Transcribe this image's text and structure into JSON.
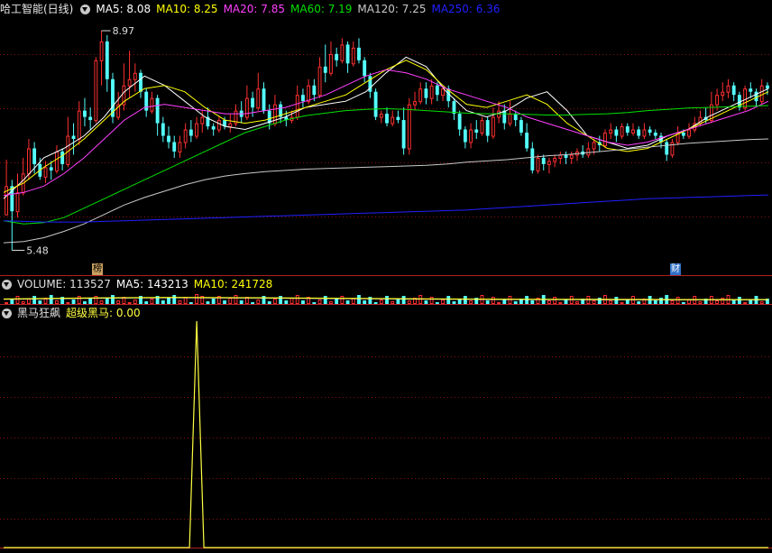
{
  "main": {
    "stock_title": "哈工智能(日线)",
    "ma": [
      {
        "label": "MA5: 8.08",
        "color": "#ffffff"
      },
      {
        "label": "MA10: 8.25",
        "color": "#ffff00"
      },
      {
        "label": "MA20: 7.85",
        "color": "#ff40ff"
      },
      {
        "label": "MA60: 7.19",
        "color": "#00e000"
      },
      {
        "label": "MA120: 7.25",
        "color": "#c8c8c8"
      },
      {
        "label": "MA250: 6.36",
        "color": "#2020ff"
      }
    ],
    "high_label": "8.97",
    "low_label": "5.48",
    "tag_bang": "榜",
    "tag_cai": "财"
  },
  "volume": {
    "label": "VOLUME: 113527",
    "ma5": "MA5: 143213",
    "ma10": "MA10: 241728"
  },
  "indicator": {
    "name": "黑马狂飙",
    "line_label": "超级黑马: 0.00",
    "color": "#ffff40"
  },
  "colors": {
    "up": "#ff3030",
    "down": "#54ffff",
    "grid": "#8a1010"
  },
  "chart_data": {
    "type": "candlestick",
    "price_range": [
      5.3,
      9.2
    ],
    "max_price": 8.97,
    "min_price": 5.48,
    "candles": [
      [
        6.05,
        6.5,
        6.08,
        6.92
      ],
      [
        6.5,
        6.1,
        5.48,
        6.6
      ],
      [
        6.1,
        6.4,
        6.0,
        6.7
      ],
      [
        6.4,
        6.7,
        6.35,
        6.95
      ],
      [
        6.7,
        7.1,
        6.6,
        7.25
      ],
      [
        7.1,
        6.85,
        6.7,
        7.2
      ],
      [
        6.85,
        6.65,
        6.6,
        6.95
      ],
      [
        6.65,
        6.8,
        6.55,
        6.9
      ],
      [
        6.8,
        6.75,
        6.6,
        6.9
      ],
      [
        6.75,
        7.05,
        6.7,
        7.15
      ],
      [
        7.05,
        6.85,
        6.75,
        7.1
      ],
      [
        6.85,
        7.3,
        6.8,
        7.6
      ],
      [
        7.3,
        7.25,
        7.0,
        7.5
      ],
      [
        7.25,
        7.7,
        7.15,
        7.85
      ],
      [
        7.7,
        7.6,
        7.45,
        7.9
      ],
      [
        7.6,
        7.55,
        7.4,
        7.75
      ],
      [
        7.55,
        8.5,
        7.5,
        8.55
      ],
      [
        8.5,
        8.8,
        8.1,
        8.97
      ],
      [
        8.8,
        8.2,
        8.0,
        8.9
      ],
      [
        8.2,
        7.6,
        7.5,
        8.3
      ],
      [
        7.6,
        7.8,
        7.55,
        8.0
      ],
      [
        7.8,
        8.1,
        7.7,
        8.45
      ],
      [
        8.1,
        8.2,
        7.9,
        8.65
      ],
      [
        8.2,
        8.3,
        8.0,
        8.45
      ],
      [
        8.3,
        8.0,
        7.9,
        8.35
      ],
      [
        8.0,
        7.7,
        7.6,
        8.05
      ],
      [
        7.7,
        7.9,
        7.65,
        8.0
      ],
      [
        7.9,
        7.5,
        7.3,
        7.95
      ],
      [
        7.5,
        7.3,
        7.2,
        7.6
      ],
      [
        7.3,
        7.2,
        7.1,
        7.45
      ],
      [
        7.2,
        7.05,
        6.95,
        7.3
      ],
      [
        7.05,
        7.2,
        6.95,
        7.3
      ],
      [
        7.2,
        7.4,
        7.1,
        7.5
      ],
      [
        7.4,
        7.3,
        7.2,
        7.55
      ],
      [
        7.3,
        7.5,
        7.25,
        7.6
      ],
      [
        7.5,
        7.6,
        7.35,
        7.7
      ],
      [
        7.6,
        7.45,
        7.4,
        7.75
      ],
      [
        7.45,
        7.4,
        7.3,
        7.5
      ],
      [
        7.4,
        7.55,
        7.35,
        7.6
      ],
      [
        7.55,
        7.45,
        7.4,
        7.6
      ],
      [
        7.45,
        7.5,
        7.35,
        7.65
      ],
      [
        7.5,
        7.7,
        7.45,
        7.8
      ],
      [
        7.7,
        7.6,
        7.5,
        7.85
      ],
      [
        7.6,
        7.9,
        7.55,
        8.1
      ],
      [
        7.9,
        7.75,
        7.6,
        8.0
      ],
      [
        7.75,
        8.05,
        7.7,
        8.3
      ],
      [
        8.05,
        7.7,
        7.65,
        8.15
      ],
      [
        7.7,
        7.5,
        7.4,
        7.8
      ],
      [
        7.5,
        7.8,
        7.45,
        7.95
      ],
      [
        7.8,
        7.6,
        7.5,
        7.85
      ],
      [
        7.6,
        7.55,
        7.45,
        7.7
      ],
      [
        7.55,
        7.6,
        7.5,
        7.7
      ],
      [
        7.6,
        7.95,
        7.55,
        8.1
      ],
      [
        7.95,
        7.85,
        7.75,
        8.05
      ],
      [
        7.85,
        8.1,
        7.8,
        8.2
      ],
      [
        8.1,
        7.95,
        7.85,
        8.2
      ],
      [
        7.95,
        8.4,
        7.9,
        8.55
      ],
      [
        8.4,
        8.3,
        8.15,
        8.75
      ],
      [
        8.3,
        8.6,
        8.25,
        8.8
      ],
      [
        8.6,
        8.5,
        8.4,
        8.7
      ],
      [
        8.5,
        8.75,
        8.45,
        8.85
      ],
      [
        8.75,
        8.45,
        8.3,
        8.8
      ],
      [
        8.45,
        8.7,
        8.4,
        8.8
      ],
      [
        8.7,
        8.5,
        8.45,
        8.85
      ],
      [
        8.5,
        8.25,
        8.15,
        8.55
      ],
      [
        8.25,
        8.0,
        7.9,
        8.3
      ],
      [
        8.0,
        7.6,
        7.55,
        8.05
      ],
      [
        7.6,
        7.65,
        7.5,
        7.7
      ],
      [
        7.65,
        7.5,
        7.45,
        7.75
      ],
      [
        7.5,
        7.6,
        7.45,
        7.7
      ],
      [
        7.6,
        7.55,
        7.5,
        7.7
      ],
      [
        7.55,
        7.1,
        7.0,
        7.75
      ],
      [
        7.1,
        7.8,
        7.0,
        7.9
      ],
      [
        7.8,
        7.85,
        7.7,
        8.0
      ],
      [
        7.85,
        8.05,
        7.8,
        8.15
      ],
      [
        8.05,
        7.9,
        7.8,
        8.15
      ],
      [
        7.9,
        8.1,
        7.8,
        8.2
      ],
      [
        8.1,
        7.95,
        7.85,
        8.15
      ],
      [
        7.95,
        8.05,
        7.85,
        8.1
      ],
      [
        8.05,
        7.85,
        7.75,
        8.1
      ],
      [
        7.85,
        7.65,
        7.55,
        7.9
      ],
      [
        7.65,
        7.4,
        7.3,
        7.7
      ],
      [
        7.4,
        7.2,
        7.1,
        7.45
      ],
      [
        7.2,
        7.4,
        7.1,
        7.5
      ],
      [
        7.4,
        7.35,
        7.25,
        7.55
      ],
      [
        7.35,
        7.55,
        7.3,
        7.6
      ],
      [
        7.55,
        7.3,
        7.2,
        7.6
      ],
      [
        7.3,
        7.6,
        7.25,
        7.75
      ],
      [
        7.6,
        7.7,
        7.5,
        7.85
      ],
      [
        7.7,
        7.5,
        7.4,
        7.8
      ],
      [
        7.5,
        7.65,
        7.45,
        7.85
      ],
      [
        7.65,
        7.55,
        7.45,
        7.7
      ],
      [
        7.55,
        7.35,
        7.3,
        7.6
      ],
      [
        7.35,
        7.1,
        7.05,
        7.5
      ],
      [
        7.1,
        6.75,
        6.7,
        7.2
      ],
      [
        6.75,
        6.95,
        6.7,
        7.0
      ],
      [
        6.95,
        6.85,
        6.75,
        7.0
      ],
      [
        6.85,
        6.9,
        6.7,
        6.95
      ],
      [
        6.9,
        6.95,
        6.8,
        7.0
      ],
      [
        6.95,
        7.0,
        6.85,
        7.05
      ],
      [
        7.0,
        6.95,
        6.85,
        7.05
      ],
      [
        6.95,
        7.0,
        6.85,
        7.05
      ],
      [
        7.0,
        7.05,
        6.9,
        7.1
      ],
      [
        7.05,
        7.0,
        6.95,
        7.15
      ],
      [
        7.0,
        7.1,
        6.95,
        7.2
      ],
      [
        7.1,
        7.2,
        7.0,
        7.25
      ],
      [
        7.2,
        7.15,
        7.05,
        7.3
      ],
      [
        7.15,
        7.35,
        7.1,
        7.4
      ],
      [
        7.35,
        7.4,
        7.25,
        7.5
      ],
      [
        7.4,
        7.3,
        7.2,
        7.45
      ],
      [
        7.3,
        7.45,
        7.25,
        7.5
      ],
      [
        7.45,
        7.35,
        7.3,
        7.5
      ],
      [
        7.35,
        7.4,
        7.3,
        7.5
      ],
      [
        7.4,
        7.3,
        7.25,
        7.45
      ],
      [
        7.3,
        7.4,
        7.25,
        7.5
      ],
      [
        7.4,
        7.35,
        7.3,
        7.45
      ],
      [
        7.35,
        7.3,
        7.25,
        7.4
      ],
      [
        7.3,
        7.2,
        7.1,
        7.35
      ],
      [
        7.2,
        7.0,
        6.9,
        7.25
      ],
      [
        7.0,
        7.2,
        6.95,
        7.25
      ],
      [
        7.2,
        7.35,
        7.15,
        7.45
      ],
      [
        7.35,
        7.3,
        7.25,
        7.4
      ],
      [
        7.3,
        7.4,
        7.25,
        7.5
      ],
      [
        7.4,
        7.5,
        7.35,
        7.6
      ],
      [
        7.5,
        7.6,
        7.45,
        7.7
      ],
      [
        7.6,
        7.55,
        7.5,
        7.75
      ],
      [
        7.55,
        7.8,
        7.5,
        8.0
      ],
      [
        7.8,
        7.95,
        7.7,
        8.05
      ],
      [
        7.95,
        8.0,
        7.85,
        8.15
      ],
      [
        8.0,
        8.1,
        7.9,
        8.2
      ],
      [
        8.1,
        7.95,
        7.85,
        8.15
      ],
      [
        7.95,
        7.75,
        7.7,
        8.0
      ],
      [
        7.75,
        8.05,
        7.7,
        8.1
      ],
      [
        8.05,
        8.0,
        7.9,
        8.15
      ],
      [
        8.0,
        7.85,
        7.75,
        8.05
      ],
      [
        7.85,
        8.1,
        7.8,
        8.2
      ],
      [
        8.1,
        8.05,
        7.95,
        8.15
      ]
    ],
    "ma_lines": [
      {
        "name": "MA5",
        "color": "#ffffff",
        "values": [
          6.3,
          6.6,
          6.95,
          7.1,
          7.3,
          7.6,
          8.0,
          8.25,
          8.1,
          7.85,
          7.6,
          7.45,
          7.4,
          7.5,
          7.6,
          7.75,
          7.8,
          7.85,
          8.0,
          8.3,
          8.55,
          8.4,
          8.0,
          7.7,
          7.6,
          7.7,
          7.9,
          8.0,
          7.7,
          7.3,
          7.2,
          7.1,
          7.15,
          7.3,
          7.4,
          7.6,
          7.75,
          7.9,
          8.05
        ]
      },
      {
        "name": "MA10",
        "color": "#ffff00",
        "values": [
          6.4,
          6.55,
          6.8,
          7.0,
          7.25,
          7.55,
          7.85,
          8.05,
          8.1,
          8.0,
          7.75,
          7.55,
          7.5,
          7.55,
          7.65,
          7.75,
          7.85,
          7.95,
          8.15,
          8.35,
          8.5,
          8.35,
          8.05,
          7.8,
          7.75,
          7.85,
          7.95,
          7.8,
          7.5,
          7.3,
          7.1,
          7.05,
          7.1,
          7.25,
          7.4,
          7.55,
          7.7,
          7.85,
          8.0
        ]
      },
      {
        "name": "MA20",
        "color": "#ff40ff",
        "values": [
          6.35,
          6.4,
          6.5,
          6.7,
          6.95,
          7.25,
          7.55,
          7.75,
          7.8,
          7.75,
          7.7,
          7.65,
          7.65,
          7.7,
          7.75,
          7.85,
          7.95,
          8.1,
          8.25,
          8.35,
          8.3,
          8.2,
          8.05,
          7.95,
          7.85,
          7.75,
          7.6,
          7.5,
          7.4,
          7.3,
          7.2,
          7.15,
          7.2,
          7.3,
          7.4,
          7.5,
          7.6,
          7.7,
          7.85
        ]
      },
      {
        "name": "MA60",
        "color": "#00e000",
        "values": [
          5.95,
          5.9,
          5.92,
          6.0,
          6.15,
          6.3,
          6.45,
          6.6,
          6.75,
          6.9,
          7.05,
          7.2,
          7.35,
          7.45,
          7.55,
          7.62,
          7.66,
          7.7,
          7.72,
          7.73,
          7.72,
          7.7,
          7.68,
          7.66,
          7.65,
          7.65,
          7.64,
          7.63,
          7.63,
          7.64,
          7.65,
          7.67,
          7.7,
          7.72,
          7.74,
          7.75,
          7.76,
          7.77,
          7.78
        ]
      },
      {
        "name": "MA120",
        "color": "#c8c8c8",
        "values": [
          5.6,
          5.62,
          5.68,
          5.78,
          5.9,
          6.05,
          6.2,
          6.32,
          6.42,
          6.52,
          6.6,
          6.66,
          6.7,
          6.73,
          6.75,
          6.77,
          6.78,
          6.79,
          6.8,
          6.81,
          6.82,
          6.83,
          6.85,
          6.88,
          6.9,
          6.92,
          6.95,
          6.98,
          7.0,
          7.03,
          7.06,
          7.09,
          7.12,
          7.15,
          7.18,
          7.2,
          7.22,
          7.24,
          7.25
        ]
      },
      {
        "name": "MA250",
        "color": "#2020ff",
        "values": [
          5.95,
          5.94,
          5.93,
          5.93,
          5.93,
          5.94,
          5.95,
          5.96,
          5.97,
          5.98,
          5.99,
          6.0,
          6.01,
          6.02,
          6.03,
          6.04,
          6.05,
          6.06,
          6.07,
          6.08,
          6.09,
          6.1,
          6.11,
          6.12,
          6.14,
          6.16,
          6.18,
          6.2,
          6.22,
          6.24,
          6.26,
          6.28,
          6.3,
          6.31,
          6.32,
          6.33,
          6.34,
          6.35,
          6.36
        ]
      }
    ],
    "volume_ma": [
      0.4,
      0.55,
      0.62,
      0.58,
      0.5,
      0.42,
      0.38,
      0.35,
      0.33,
      0.32
    ],
    "indicator_values": {
      "range": [
        0,
        1
      ],
      "spike_index": 34,
      "spike_value": 1
    }
  }
}
